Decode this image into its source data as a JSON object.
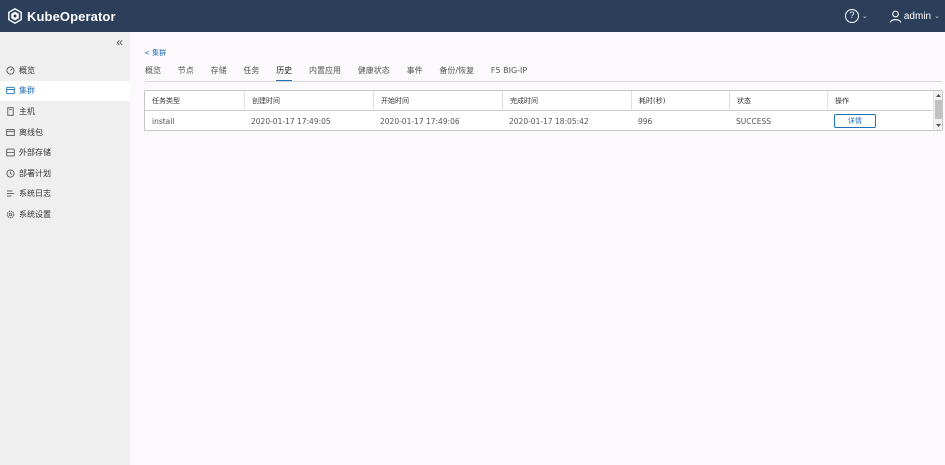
{
  "header": {
    "brand": "KubeOperator",
    "help_glyph": "?",
    "user": "admin",
    "colors": {
      "bar": "#2b3f5a",
      "accent": "#1f6fb2"
    }
  },
  "sidebar": {
    "collapse_glyph": "«",
    "items": [
      {
        "label": "概览",
        "icon": "dashboard-icon"
      },
      {
        "label": "集群",
        "icon": "cluster-icon",
        "active": true
      },
      {
        "label": "主机",
        "icon": "host-icon"
      },
      {
        "label": "离线包",
        "icon": "package-icon"
      },
      {
        "label": "外部存储",
        "icon": "storage-icon"
      },
      {
        "label": "部署计划",
        "icon": "clock-icon"
      },
      {
        "label": "系统日志",
        "icon": "list-icon"
      },
      {
        "label": "系统设置",
        "icon": "gear-icon"
      }
    ]
  },
  "breadcrumb": {
    "back": "< 集群"
  },
  "tabs": [
    "概览",
    "节点",
    "存储",
    "任务",
    "历史",
    "内置应用",
    "健康状态",
    "事件",
    "备份/恢复",
    "F5 BIG-IP"
  ],
  "active_tab": "历史",
  "table": {
    "headers": [
      "任务类型",
      "创建时间",
      "开始时间",
      "完成时间",
      "耗时(秒)",
      "状态",
      "操作"
    ],
    "rows": [
      {
        "type": "install",
        "created": "2020-01-17 17:49:05",
        "started": "2020-01-17 17:49:06",
        "finished": "2020-01-17 18:05:42",
        "duration": "996",
        "status": "SUCCESS",
        "action": "详情"
      }
    ]
  }
}
